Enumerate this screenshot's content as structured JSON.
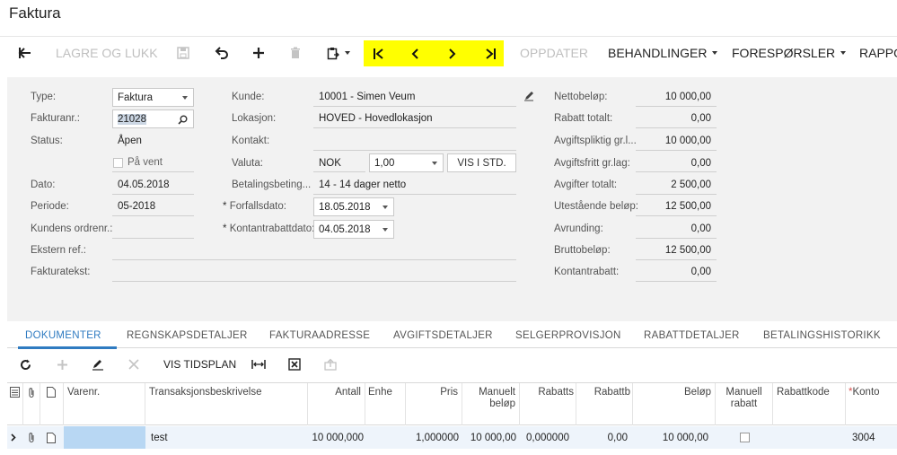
{
  "page_title": "Faktura",
  "toolbar": {
    "save_close": "LAGRE OG LUKK",
    "update": "OPPDATER",
    "actions": "BEHANDLINGER",
    "inquiries": "FORESPØRSLER",
    "reports": "RAPPO"
  },
  "form": {
    "type_label": "Type:",
    "type_value": "Faktura",
    "invoice_no_label": "Fakturanr.:",
    "invoice_no_value": "21028",
    "status_label": "Status:",
    "status_value": "Åpen",
    "hold_label": "På vent",
    "date_label": "Dato:",
    "date_value": "04.05.2018",
    "period_label": "Periode:",
    "period_value": "05-2018",
    "customer_order_label": "Kundens ordrenr.:",
    "external_ref_label": "Ekstern ref.:",
    "invoice_text_label": "Fakturatekst:",
    "customer_label": "Kunde:",
    "customer_value": "10001 - Simen Veum",
    "location_label": "Lokasjon:",
    "location_value": "HOVED - Hovedlokasjon",
    "contact_label": "Kontakt:",
    "currency_label": "Valuta:",
    "currency_value": "NOK",
    "rate_value": "1,00",
    "view_base_label": "VIS I STD.",
    "terms_label": "Betalingsbeting...",
    "terms_value": "14 - 14 dager netto",
    "due_date_label": "Forfallsdato:",
    "due_date_value": "18.05.2018",
    "cash_discount_date_label": "Kontantrabattdato:",
    "cash_discount_date_value": "04.05.2018",
    "required_mark": "*"
  },
  "totals": [
    {
      "label": "Nettobeløp:",
      "value": "10 000,00"
    },
    {
      "label": "Rabatt totalt:",
      "value": "0,00"
    },
    {
      "label": "Avgiftspliktig gr.l...",
      "value": "10 000,00"
    },
    {
      "label": "Avgiftsfritt gr.lag:",
      "value": "0,00"
    },
    {
      "label": "Avgifter totalt:",
      "value": "2 500,00"
    },
    {
      "label": "Utestående beløp:",
      "value": "12 500,00"
    },
    {
      "label": "Avrunding:",
      "value": "0,00"
    },
    {
      "label": "Bruttobeløp:",
      "value": "12 500,00"
    },
    {
      "label": "Kontantrabatt:",
      "value": "0,00"
    }
  ],
  "tabs": [
    "DOKUMENTER",
    "REGNSKAPSDETALJER",
    "FAKTURAADRESSE",
    "AVGIFTSDETALJER",
    "SELGERPROVISJON",
    "RABATTDETALJER",
    "BETALINGSHISTORIKK"
  ],
  "grid_toolbar": {
    "schedule": "VIS TIDSPLAN"
  },
  "columns": {
    "item": "Varenr.",
    "description": "Transaksjonsbeskrivelse",
    "qty": "Antall",
    "uom": "Enhe",
    "price": "Pris",
    "manual_amount_1": "Manuelt",
    "manual_amount_2": "beløp",
    "discount_pct": "Rabatts",
    "discount_amt": "Rabattb",
    "amount": "Beløp",
    "manual_discount_1": "Manuell",
    "manual_discount_2": "rabatt",
    "discount_code": "Rabattkode",
    "account": "Konto"
  },
  "rows": [
    {
      "description": "test",
      "qty": "10 000,000",
      "price": "1,000000",
      "manual_amount": "10 000,00",
      "discount_pct": "0,000000",
      "discount_amt": "0,00",
      "amount": "10 000,00",
      "account": "3004"
    }
  ],
  "colors": {
    "accent": "#2f7bc1",
    "highlight": "#ffff00",
    "form_bg": "#f2f2f2"
  }
}
